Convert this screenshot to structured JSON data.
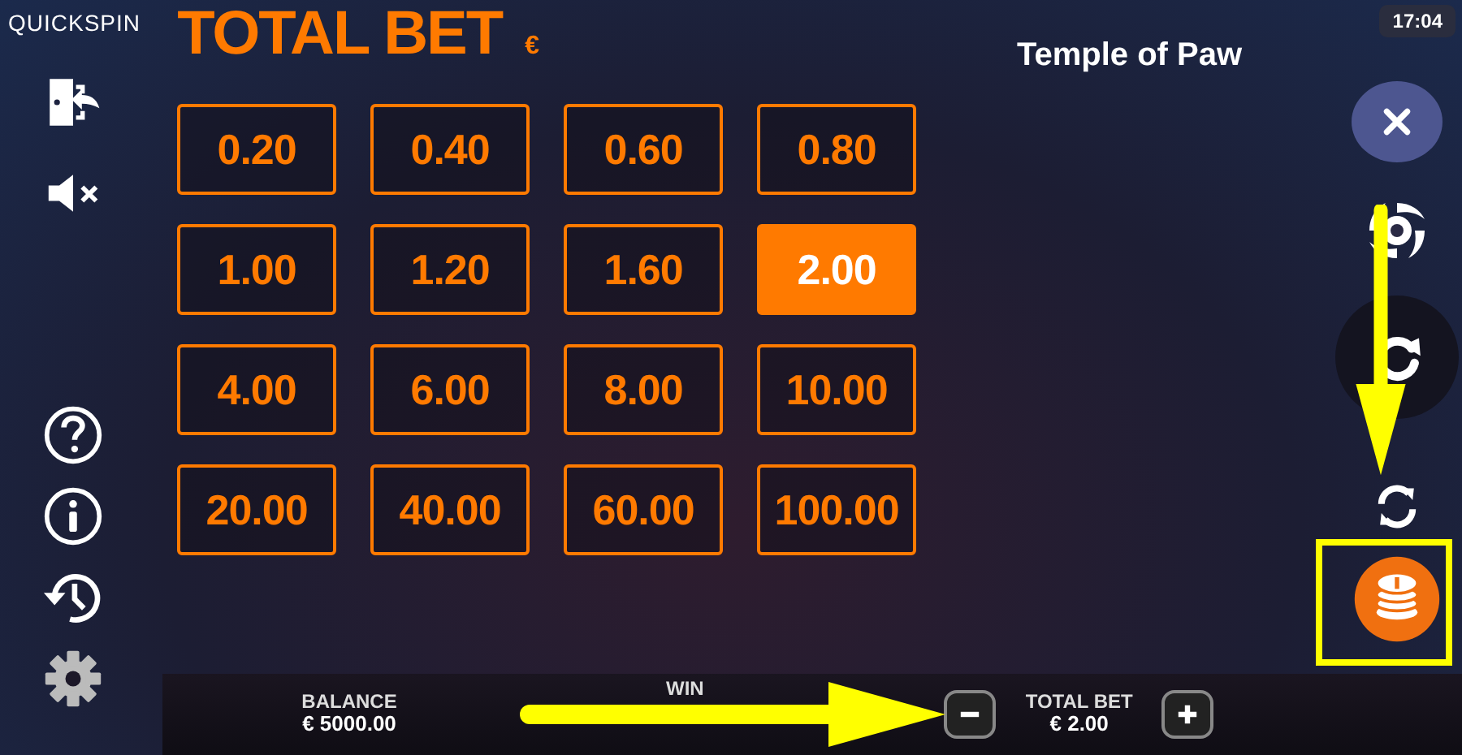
{
  "brand": "QUICKSPIN",
  "title": "TOTAL BET",
  "currency": "€",
  "game_title": "Temple of Paw",
  "clock": "17:04",
  "bets": [
    {
      "label": "0.20",
      "selected": false
    },
    {
      "label": "0.40",
      "selected": false
    },
    {
      "label": "0.60",
      "selected": false
    },
    {
      "label": "0.80",
      "selected": false
    },
    {
      "label": "1.00",
      "selected": false
    },
    {
      "label": "1.20",
      "selected": false
    },
    {
      "label": "1.60",
      "selected": false
    },
    {
      "label": "2.00",
      "selected": true
    },
    {
      "label": "4.00",
      "selected": false
    },
    {
      "label": "6.00",
      "selected": false
    },
    {
      "label": "8.00",
      "selected": false
    },
    {
      "label": "10.00",
      "selected": false
    },
    {
      "label": "20.00",
      "selected": false
    },
    {
      "label": "40.00",
      "selected": false
    },
    {
      "label": "60.00",
      "selected": false
    },
    {
      "label": "100.00",
      "selected": false
    }
  ],
  "footer": {
    "balance_label": "BALANCE",
    "balance": "€ 5000.00",
    "win_label": "WIN",
    "bet_label": "TOTAL BET",
    "bet": "€ 2.00"
  }
}
